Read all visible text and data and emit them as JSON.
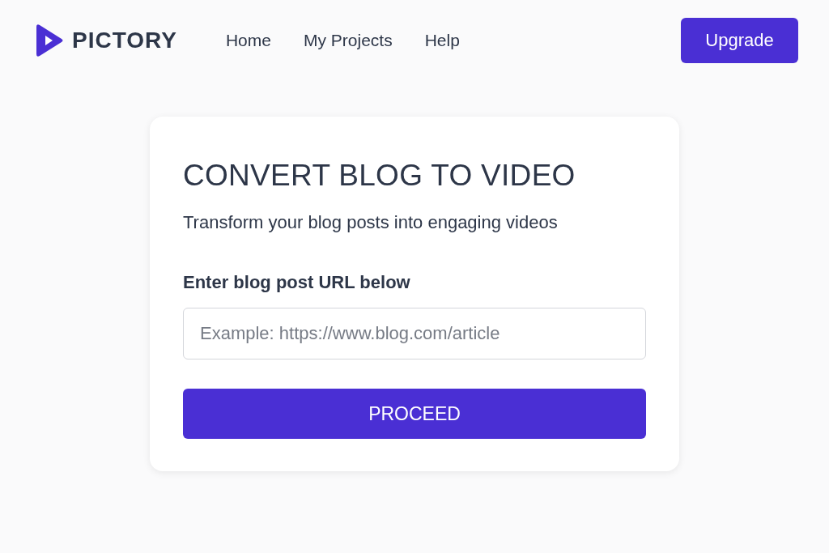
{
  "header": {
    "logo": {
      "text": "PICTORY"
    },
    "nav": [
      {
        "label": "Home"
      },
      {
        "label": "My Projects"
      },
      {
        "label": "Help"
      }
    ],
    "upgrade_button": "Upgrade"
  },
  "card": {
    "title": "CONVERT BLOG TO VIDEO",
    "subtitle": "Transform your blog posts into engaging videos",
    "field_label": "Enter blog post URL below",
    "url_field": {
      "placeholder": "Example: https://www.blog.com/article"
    },
    "proceed_button": "PROCEED"
  }
}
